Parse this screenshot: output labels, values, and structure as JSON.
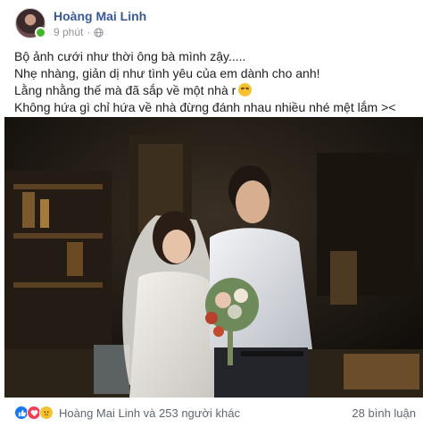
{
  "post": {
    "author": "Hoàng Mai Linh",
    "time": "9 phút",
    "separator": "·",
    "privacy_icon": "globe-icon",
    "text_lines": [
      "Bộ ảnh cưới như thời ông bà mình zậy.....",
      "Nhẹ nhàng, giản dị như tình yêu của em dành cho anh!",
      "Lằng nhằng thế mà đã sắp về một nhà r",
      "Không hứa gì chỉ hứa về nhà đừng đánh nhau nhiều nhé mệt lắm ><"
    ],
    "image_alt": "wedding photo"
  },
  "footer": {
    "reaction_icons": [
      "like-icon",
      "love-icon",
      "sad-icon"
    ],
    "reactions_text": "Hoàng Mai Linh và 253 người khác",
    "comments_text": "28 bình luận"
  },
  "colors": {
    "name": "#385898",
    "meta": "#90949c",
    "like": "#1877f2",
    "love": "#f33e58",
    "sad": "#f7c22e"
  }
}
